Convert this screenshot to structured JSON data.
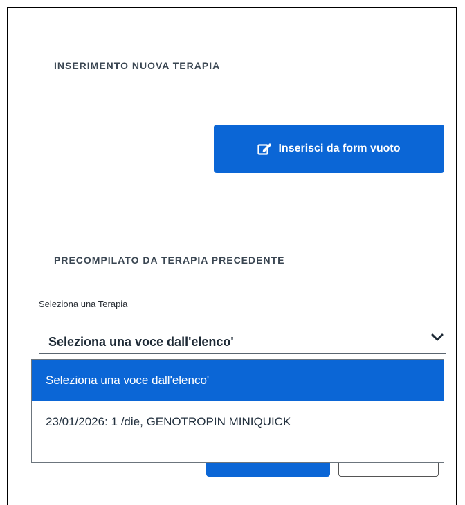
{
  "sections": {
    "new_therapy_title": "INSERIMENTO NUOVA TERAPIA",
    "previous_therapy_title": "PRECOMPILATO DA TERAPIA PRECEDENTE"
  },
  "actions": {
    "insert_empty_label": "Inserisci da form vuoto",
    "insert_empty_icon": "edit-icon"
  },
  "therapy_select": {
    "label": "Seleziona una Terapia",
    "selected_value": "Seleziona una voce dall'elenco'",
    "options": [
      "Seleziona una voce dall'elenco'",
      "23/01/2026: 1 /die, GENOTROPIN MINIQUICK"
    ]
  },
  "colors": {
    "primary": "#0b66d6",
    "text": "#1e2a36"
  }
}
